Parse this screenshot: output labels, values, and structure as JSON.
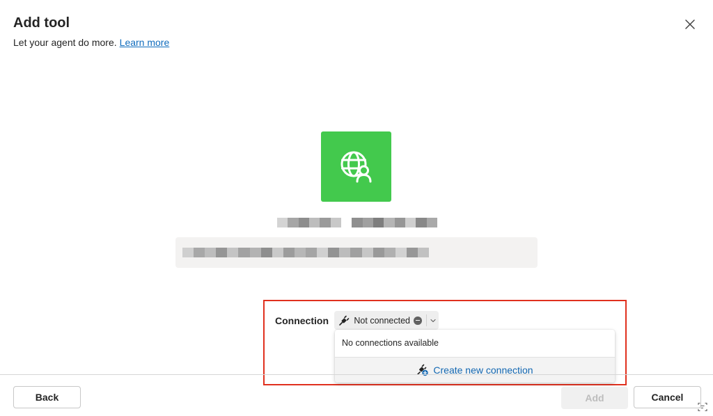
{
  "dialog": {
    "title": "Add tool",
    "subtitle": "Let your agent do more.",
    "learn_more": "Learn more",
    "close_icon": "close-icon"
  },
  "tool": {
    "icon": "globe-person-icon",
    "icon_bg": "#43c94d",
    "name_redacted": true,
    "description_redacted": true
  },
  "connection": {
    "label": "Connection",
    "status": "Not connected",
    "status_icon": "plug-icon",
    "dropdown": {
      "empty_message": "No connections available",
      "create_label": "Create new connection",
      "create_icon": "plug-add-icon"
    }
  },
  "highlight_color": "#e0301e",
  "footer": {
    "back": "Back",
    "add": "Add",
    "cancel": "Cancel"
  }
}
